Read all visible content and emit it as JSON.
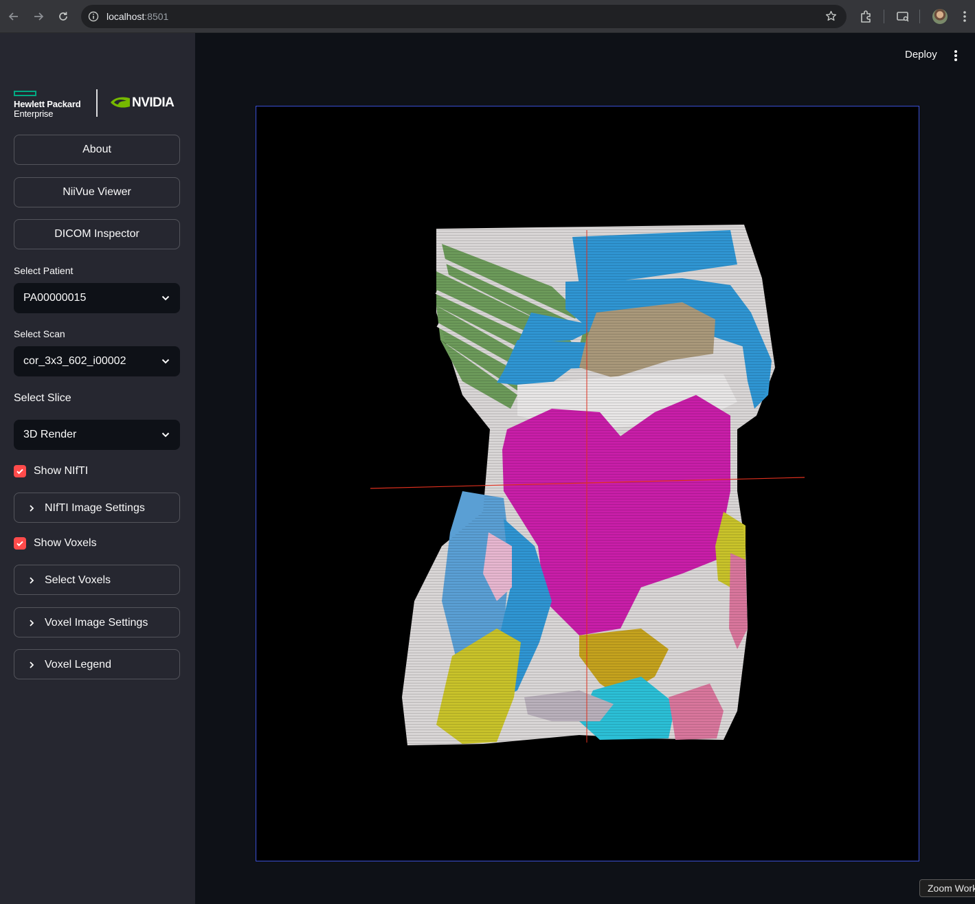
{
  "browser": {
    "url_host": "localhost",
    "url_port": ":8501",
    "icons": [
      "back-icon",
      "forward-icon",
      "reload-icon",
      "site-info-icon",
      "bookmark-star-icon",
      "extensions-icon",
      "cast-icon",
      "profile-avatar",
      "menu-icon"
    ]
  },
  "sidebar": {
    "logo": {
      "hpe_line1": "Hewlett Packard",
      "hpe_line2": "Enterprise",
      "nvidia_text": "NVIDIA"
    },
    "nav_buttons": [
      {
        "label": "About"
      },
      {
        "label": "NiiVue Viewer"
      },
      {
        "label": "DICOM Inspector"
      }
    ],
    "patient": {
      "label": "Select Patient",
      "value": "PA00000015"
    },
    "scan": {
      "label": "Select Scan",
      "value": "cor_3x3_602_i00002"
    },
    "slice": {
      "label": "Select Slice",
      "value": "3D Render"
    },
    "show_nifti": {
      "label": "Show NIfTI",
      "checked": true
    },
    "nifti_settings": {
      "label": "NIfTI Image Settings"
    },
    "show_voxels": {
      "label": "Show Voxels",
      "checked": true
    },
    "select_voxels": {
      "label": "Select Voxels"
    },
    "voxel_settings": {
      "label": "Voxel Image Settings"
    },
    "voxel_legend": {
      "label": "Voxel Legend"
    }
  },
  "header": {
    "deploy_label": "Deploy"
  },
  "viewer": {
    "content": "3D volume render of abdominal/thoracic CT segmentation",
    "colors": {
      "bone": "#d9d6d6",
      "ribs_left": "#6c9a5a",
      "ribs_right": "#2f95d2",
      "intestine": "#c81ea8",
      "liver": "#a9987a",
      "hip_yellow": "#c8c22a",
      "muscle_blue": "#5a9fd4",
      "cyan": "#2bbfd6",
      "pink": "#d8769c",
      "crosshair": "#e0301e",
      "border": "#3b4fd6"
    }
  },
  "tooltip": {
    "text": "Zoom Work"
  },
  "theme": {
    "accent": "#ff4b4b",
    "sidebar_bg": "#262730",
    "main_bg": "#0e1117"
  }
}
